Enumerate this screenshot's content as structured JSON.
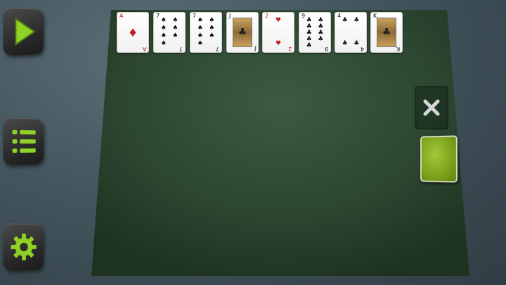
{
  "controls": {
    "play_icon": "play-triangle-icon",
    "menu_icon": "list-menu-icon",
    "settings_icon": "gear-icon"
  },
  "colors": {
    "accent_green": "#8fd124",
    "felt": "#2d4a31",
    "card_back": "#8fb828"
  },
  "foundation_row": [
    {
      "rank": "A",
      "suit": "♦",
      "color": "red",
      "kind": "pip",
      "count": 1
    },
    {
      "rank": "7",
      "suit": "♠",
      "color": "black",
      "kind": "pip",
      "count": 7
    },
    {
      "rank": "7",
      "suit": "♠",
      "color": "black",
      "kind": "pip",
      "count": 7
    },
    {
      "rank": "J",
      "suit": "♣",
      "color": "black",
      "kind": "face",
      "count": 0
    },
    {
      "rank": "2",
      "suit": "♥",
      "color": "red",
      "kind": "pip",
      "count": 2
    },
    {
      "rank": "9",
      "suit": "♣",
      "color": "black",
      "kind": "pip",
      "count": 9
    },
    {
      "rank": "4",
      "suit": "♣",
      "color": "black",
      "kind": "pip",
      "count": 4
    },
    {
      "rank": "K",
      "suit": "♣",
      "color": "black",
      "kind": "face",
      "count": 0
    }
  ],
  "discard": {
    "icon": "close-x-icon"
  },
  "stock": {
    "icon": "card-back"
  }
}
